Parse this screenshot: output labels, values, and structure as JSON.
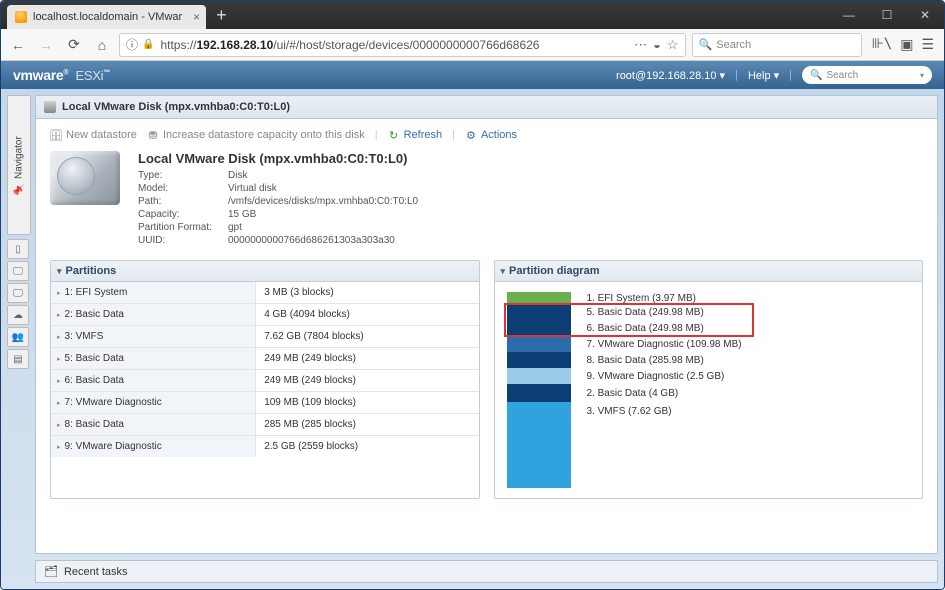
{
  "browser": {
    "tab_title": "localhost.localdomain - VMwar",
    "url_host": "192.168.28.10",
    "url_path": "/ui/#/host/storage/devices/0000000000766d68626",
    "search_placeholder": "Search"
  },
  "esxi": {
    "logo_vm": "vmware",
    "logo_esxi": " ESXi",
    "user": "root@192.168.28.10",
    "help": "Help",
    "search_placeholder": "Search"
  },
  "navigator_label": "Navigator",
  "header_title": "Local VMware Disk (mpx.vmhba0:C0:T0:L0)",
  "toolbar": {
    "new_datastore": "New datastore",
    "increase": "Increase datastore capacity onto this disk",
    "refresh": "Refresh",
    "actions": "Actions"
  },
  "disk": {
    "title": "Local VMware Disk (mpx.vmhba0:C0:T0:L0)",
    "labels": {
      "type": "Type:",
      "model": "Model:",
      "path": "Path:",
      "capacity": "Capacity:",
      "pfmt": "Partition Format:",
      "uuid": "UUID:"
    },
    "type": "Disk",
    "model": "Virtual disk",
    "path": "/vmfs/devices/disks/mpx.vmhba0:C0:T0:L0",
    "capacity": "15 GB",
    "pfmt": "gpt",
    "uuid": "0000000000766d686261303a303a30"
  },
  "partitions_label": "Partitions",
  "partitions": [
    {
      "name": "1: EFI System",
      "size": "3 MB (3 blocks)"
    },
    {
      "name": "2: Basic Data",
      "size": "4 GB (4094 blocks)"
    },
    {
      "name": "3: VMFS",
      "size": "7.62 GB (7804 blocks)"
    },
    {
      "name": "5: Basic Data",
      "size": "249 MB (249 blocks)"
    },
    {
      "name": "6: Basic Data",
      "size": "249 MB (249 blocks)"
    },
    {
      "name": "7: VMware Diagnostic",
      "size": "109 MB (109 blocks)"
    },
    {
      "name": "8: Basic Data",
      "size": "285 MB (285 blocks)"
    },
    {
      "name": "9: VMware Diagnostic",
      "size": "2.5 GB (2559 blocks)"
    }
  ],
  "diagram_label": "Partition diagram",
  "diagram": [
    {
      "label": "1. EFI System  (3.97 MB)",
      "seg": "green",
      "h": 12
    },
    {
      "label": "5. Basic Data  (249.98 MB)",
      "seg": "darkblue",
      "h": 16
    },
    {
      "label": "6. Basic Data  (249.98 MB)",
      "seg": "darkblue",
      "h": 16
    },
    {
      "label": "7. VMware Diagnostic  (109.98 MB)",
      "seg": "midblue",
      "h": 16
    },
    {
      "label": "8. Basic Data  (285.98 MB)",
      "seg": "darkblue",
      "h": 16
    },
    {
      "label": "9. VMware Diagnostic  (2.5 GB)",
      "seg": "lightblue",
      "h": 16
    },
    {
      "label": "2. Basic Data  (4 GB)",
      "seg": "darkblue",
      "h": 18
    },
    {
      "label": "3. VMFS  (7.62 GB)",
      "seg": "sky",
      "h": 86
    }
  ],
  "recent_tasks": "Recent tasks"
}
